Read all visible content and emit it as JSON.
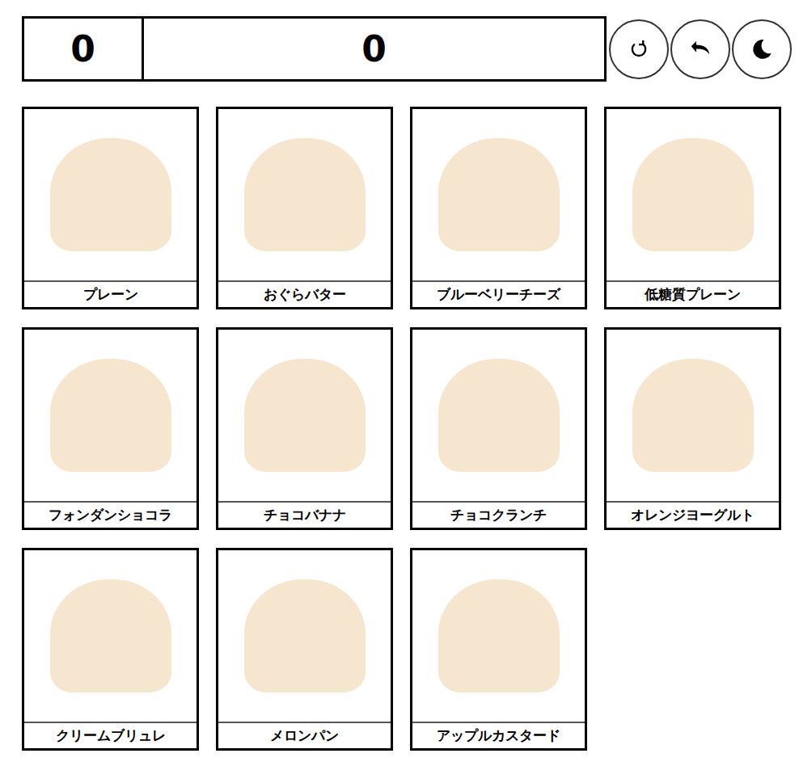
{
  "counter": {
    "left": "0",
    "right": "0"
  },
  "toolbar": [
    "reset",
    "undo",
    "theme"
  ],
  "items": [
    {
      "name": "プレーン"
    },
    {
      "name": "おぐらバター"
    },
    {
      "name": "ブルーベリーチーズ"
    },
    {
      "name": "低糖質プレーン"
    },
    {
      "name": "フォンダンショコラ"
    },
    {
      "name": "チョコバナナ"
    },
    {
      "name": "チョコクランチ"
    },
    {
      "name": "オレンジヨーグルト"
    },
    {
      "name": "クリームブリュレ"
    },
    {
      "name": "メロンパン"
    },
    {
      "name": "アップルカスタード"
    }
  ]
}
